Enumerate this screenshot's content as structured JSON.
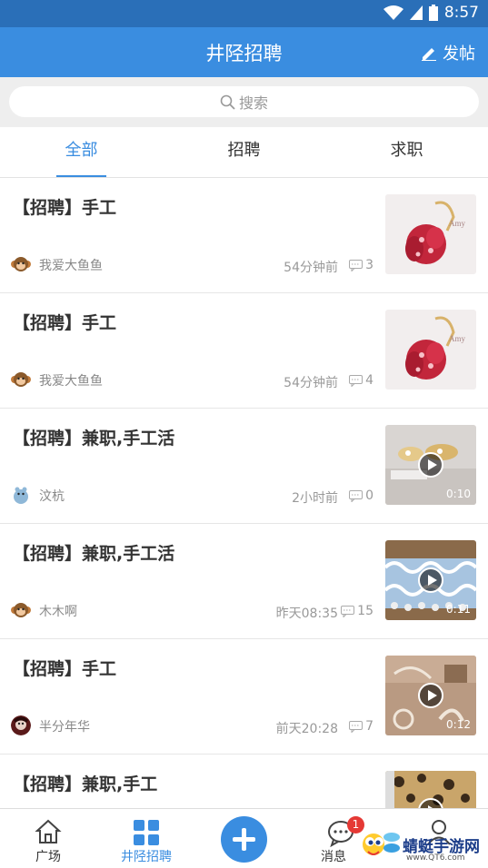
{
  "status_bar": {
    "time": "8:57"
  },
  "app_bar": {
    "title": "井陉招聘",
    "post_label": "发帖"
  },
  "search": {
    "placeholder": "搜索"
  },
  "tabs": [
    {
      "label": "全部",
      "active": true
    },
    {
      "label": "招聘",
      "active": false
    },
    {
      "label": "求职",
      "active": false
    }
  ],
  "posts": [
    {
      "title": "【招聘】手工",
      "author": "我爱大鱼鱼",
      "time": "54分钟前",
      "comments": "3",
      "video": false,
      "duration": ""
    },
    {
      "title": "【招聘】手工",
      "author": "我爱大鱼鱼",
      "time": "54分钟前",
      "comments": "4",
      "video": false,
      "duration": ""
    },
    {
      "title": "【招聘】兼职,手工活",
      "author": "汶杭",
      "time": "2小时前",
      "comments": "0",
      "video": true,
      "duration": "0:10"
    },
    {
      "title": "【招聘】兼职,手工活",
      "author": "木木啊",
      "time": "昨天08:35",
      "comments": "15",
      "video": true,
      "duration": "0:11"
    },
    {
      "title": "【招聘】手工",
      "author": "半分年华",
      "time": "前天20:28",
      "comments": "7",
      "video": true,
      "duration": "0:12"
    },
    {
      "title": "【招聘】兼职,手工",
      "author": "",
      "time": "",
      "comments": "",
      "video": true,
      "duration": ""
    }
  ],
  "bottom_nav": {
    "items": [
      {
        "label": "广场",
        "icon": "home-icon"
      },
      {
        "label": "井陉招聘",
        "icon": "grid-icon",
        "active": true
      },
      {
        "label": "",
        "icon": "plus-icon"
      },
      {
        "label": "消息",
        "icon": "message-icon",
        "badge": "1"
      },
      {
        "label": "",
        "icon": "user-icon"
      }
    ]
  },
  "watermark": {
    "text": "蜻蜓手游网",
    "sub": "www.QT6.com"
  },
  "colors": {
    "primary": "#3a8de0",
    "status_bar": "#2a6fb8",
    "badge": "#e53935"
  }
}
